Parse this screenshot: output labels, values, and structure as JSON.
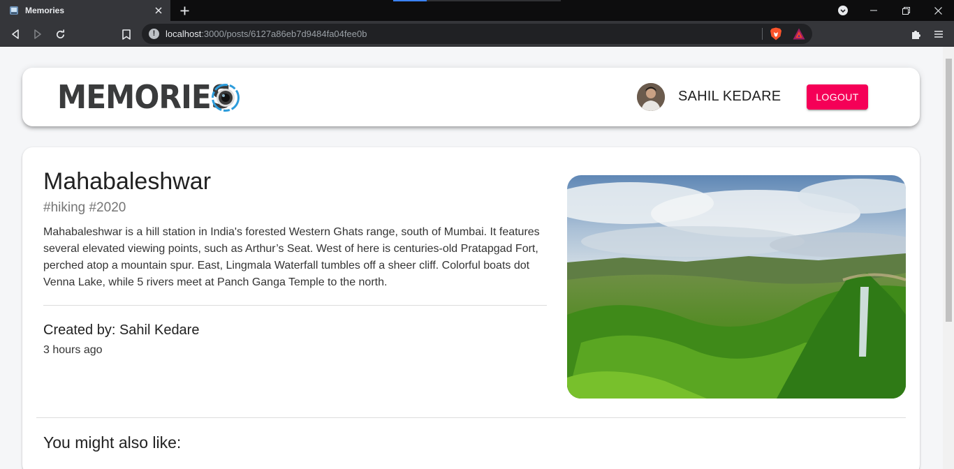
{
  "browser": {
    "tab_title": "Memories",
    "url_host": "localhost",
    "url_rest": ":3000/posts/6127a86eb7d9484fa04fee0b"
  },
  "header": {
    "brand": "MEMORIES",
    "user_name": "SAHIL KEDARE",
    "logout_label": "LOGOUT",
    "accent_color": "#f50057"
  },
  "post": {
    "title": "Mahabaleshwar",
    "tags": "#hiking #2020",
    "message": "Mahabaleshwar is a hill station in India's forested Western Ghats range, south of Mumbai. It features several elevated viewing points, such as Arthur’s Seat. West of here is centuries-old Pratapgad Fort, perched atop a mountain spur. East, Lingmala Waterfall tumbles off a sheer cliff. Colorful boats dot Venna Lake, while 5 rivers meet at Panch Ganga Temple to the north.",
    "created_by": "Created by: Sahil Kedare",
    "created_at": "3 hours ago"
  },
  "recommended": {
    "heading": "You might also like:"
  }
}
